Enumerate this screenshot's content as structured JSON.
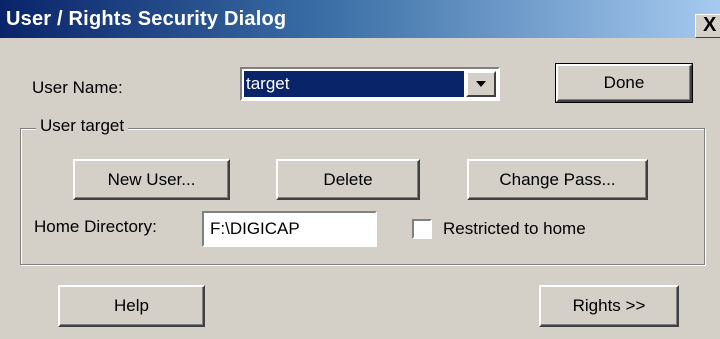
{
  "window": {
    "title": "User / Rights Security Dialog",
    "close_label": "X"
  },
  "user_name": {
    "label": "User Name:",
    "selected_value": "target"
  },
  "buttons": {
    "done": "Done",
    "new_user": "New User...",
    "delete": "Delete",
    "change_pass": "Change Pass...",
    "help": "Help",
    "rights": "Rights >>"
  },
  "group": {
    "legend": "User target",
    "home_directory_label": "Home Directory:",
    "home_directory_value": "F:\\DIGICAP",
    "restricted_label": "Restricted to home",
    "restricted_checked": false
  },
  "colors": {
    "titlebar_start": "#0a246a",
    "titlebar_end": "#a6caf0",
    "dialog_face": "#d4d0c8",
    "selection": "#0a246a"
  }
}
